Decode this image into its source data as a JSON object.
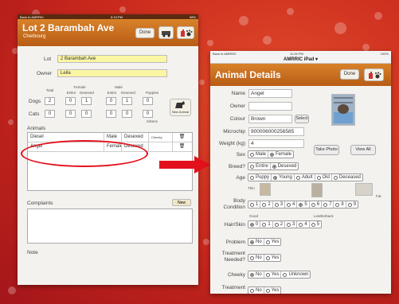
{
  "left": {
    "status_left": "Back to AMRRIC",
    "status_center": "5:19 PM",
    "status_right": "98%",
    "title": "Lot 2 Barambah Ave",
    "subtitle": "Cherbourg",
    "done_label": "Done",
    "lot_label": "Lot",
    "lot_value": "2 Barambah Ave",
    "owner_label": "Owner",
    "owner_value": "Leila",
    "total_label": "Total",
    "female_label": "Female",
    "male_label": "Male",
    "entire_label": "Entire",
    "desexed_label": "Desexed",
    "puppies_label": "Puppies",
    "kittens_label": "Kittens",
    "dogs_label": "Dogs",
    "cats_label": "Cats",
    "dogs_values": [
      "2",
      "0",
      "1",
      "0",
      "1",
      "0"
    ],
    "cats_values": [
      "0",
      "0",
      "0",
      "0",
      "0",
      "0"
    ],
    "new_animal_label": "New Animal",
    "animals_label": "Animals",
    "animals": [
      {
        "name": "Diesel",
        "sex": "Male",
        "status": "Desexed",
        "cheeky": "Cheeky"
      },
      {
        "name": "Angel",
        "sex": "Female",
        "status": "Desexed",
        "cheeky": ""
      }
    ],
    "complaints_label": "Complaints",
    "new_label": "New",
    "note_label": "Note"
  },
  "right": {
    "back_label": "Back to AMRRIC",
    "time": "11:26 PM",
    "battery": "100%",
    "device_title": "AMRRIC iPad",
    "title": "Animal Details",
    "done_label": "Done",
    "name_label": "Name",
    "name_value": "Angel",
    "owner_label": "Owner",
    "owner_value": "",
    "colour_label": "Colour",
    "colour_value": "Brown",
    "select_label": "Select",
    "microchip_label": "Microchip",
    "microchip_value": "900006000256585",
    "weight_label": "Weight (kg)",
    "weight_value": "4",
    "sex_label": "Sex",
    "sex_options": [
      "Male",
      "Female"
    ],
    "take_photo_label": "Take Photo",
    "view_all_label": "View All",
    "breed_label": "Breed?",
    "breed_options": [
      "Entire",
      "Desexed"
    ],
    "age_label": "Age",
    "age_options": [
      "Puppy",
      "Young",
      "Adult",
      "Old",
      "Deceased"
    ],
    "body_label": "Body Condition",
    "body_thin": "Thin",
    "body_fat": "Fat",
    "body_options": [
      "1",
      "2",
      "3",
      "4",
      "5",
      "6",
      "7",
      "8",
      "9"
    ],
    "hair_label": "Hair/Skin",
    "hair_good": "Good",
    "hair_leatherback": "Leatherback",
    "hair_options": [
      "0",
      "1",
      "2",
      "3",
      "4",
      "5"
    ],
    "problem_label": "Problem",
    "treatment_needed_label": "Treatment Needed?",
    "cheeky_label": "Cheeky",
    "cheeky_unknown": "Unknown",
    "treatment_label": "Treatment",
    "no_label": "No",
    "yes_label": "Yes"
  },
  "colors": {
    "header_orange": "#c86a1e",
    "highlight_red": "#e3101c",
    "field_yellow": "#fbf6a4"
  }
}
